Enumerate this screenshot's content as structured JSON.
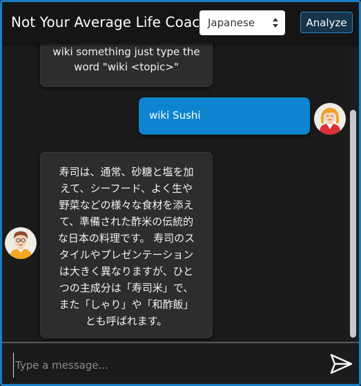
{
  "header": {
    "title": "Not Your Average Life Coach",
    "language_selected": "Japanese",
    "analyze_label": "Analyze"
  },
  "messages": {
    "bot_hint": {
      "lines": [
        "wiki something just type the",
        "word \"wiki <topic>\""
      ]
    },
    "user_message": "wiki Sushi",
    "bot_reply": {
      "lines": [
        "寿司は、通常、砂糖と塩を加",
        "えて、シーフード、よく生や",
        "野菜などの様々な食材を添え",
        "て、準備された酢米の伝統的",
        "な日本の料理です。 寿司のス",
        "タイルやプレゼンテーション",
        "は大きく異なりますが、ひと",
        "つの主成分は「寿司米」で、",
        "また「しゃり」や「和酢飯」",
        "とも呼ばれます。"
      ]
    }
  },
  "composer": {
    "placeholder": "Type a message..."
  },
  "colors": {
    "accent": "#0d84cf",
    "frame_border": "#1a7fc2",
    "bot_bubble": "#2d2d2d",
    "background": "#1b1b1b"
  },
  "icons": {
    "language_select": "up-down-arrows-icon",
    "send": "paper-plane-send-icon",
    "user_avatar": "woman-avatar-icon",
    "bot_avatar": "man-avatar-icon"
  }
}
